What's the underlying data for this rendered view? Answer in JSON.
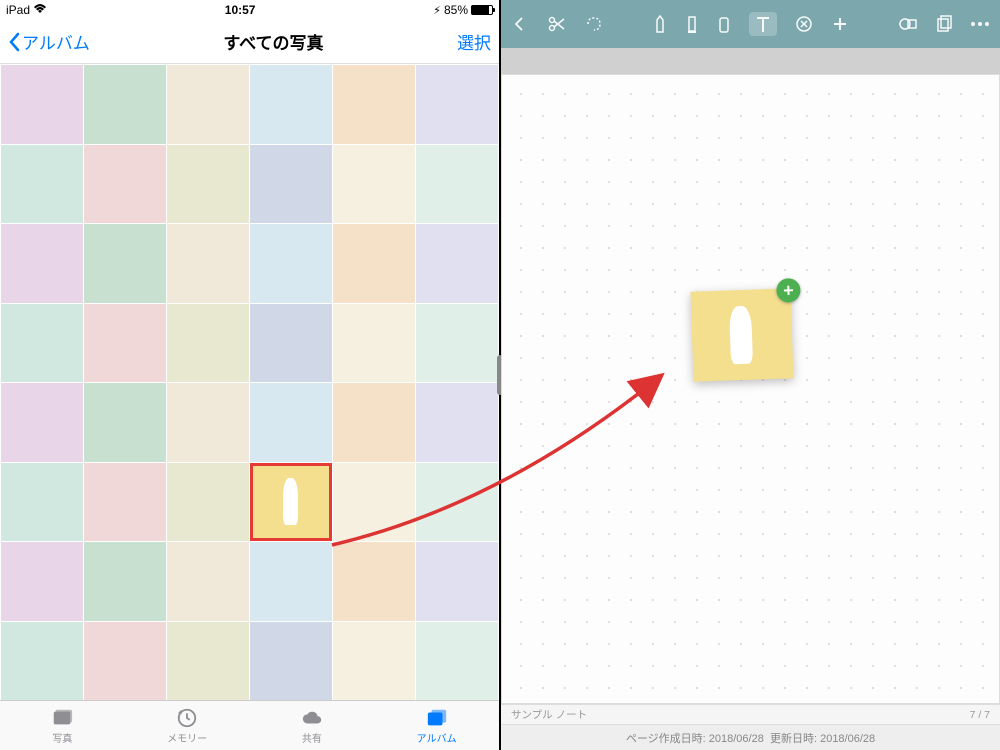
{
  "status": {
    "device": "iPad",
    "time": "10:57",
    "battery_pct": "85%"
  },
  "photos": {
    "back_label": "アルバム",
    "title": "すべての写真",
    "select_label": "選択",
    "tabs": {
      "photos": "写真",
      "memories": "メモリー",
      "shared": "共有",
      "albums": "アルバム"
    }
  },
  "note": {
    "footer_title": "サンプル ノート",
    "page_indicator": "7 / 7",
    "meta_created_label": "ページ作成日時:",
    "meta_created": "2018/06/28",
    "meta_updated_label": "更新日時:",
    "meta_updated": "2018/06/28",
    "add_badge": "+"
  },
  "grid": {
    "cols": 6,
    "rows": 8,
    "selected_index": 33
  }
}
